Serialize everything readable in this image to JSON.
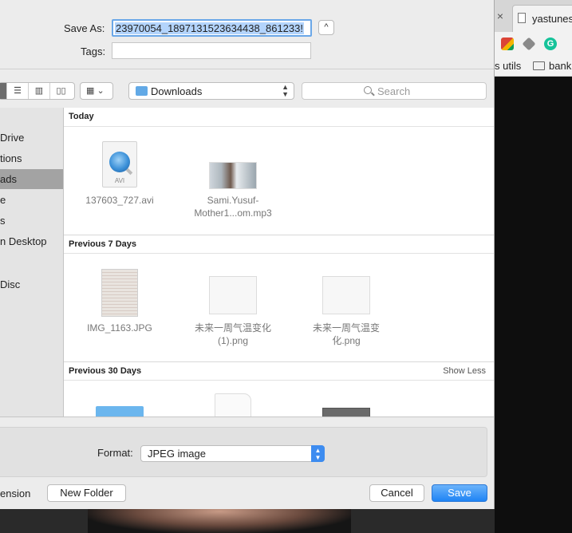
{
  "background_browser": {
    "tab_close_glyph": "×",
    "tab_title": "yastunes",
    "bookmarks": [
      "s utils",
      "bank"
    ],
    "extension_label": "G"
  },
  "save_dialog": {
    "save_as_label": "Save As:",
    "filename": "23970054_1897131523634438_861233!",
    "expand_glyph": "^",
    "tags_label": "Tags:",
    "location": "Downloads",
    "search_placeholder": "Search",
    "sidebar_items": [
      "Drive",
      "tions",
      "ads",
      "e",
      "s",
      "n Desktop",
      "Disc"
    ],
    "selected_sidebar_item": "ads",
    "groups": [
      {
        "title": "Today",
        "files": [
          {
            "name": "137603_727.avi",
            "lines": [
              "137603_727.avi"
            ],
            "kind": "avi-video",
            "ext_label": "AVI"
          },
          {
            "name": "Sami.Yusuf-Mother1...om.mp3",
            "lines": [
              "Sami.Yusuf-",
              "Mother1...om.mp3"
            ],
            "kind": "album-art"
          }
        ]
      },
      {
        "title": "Previous 7 Days",
        "files": [
          {
            "name": "IMG_1163.JPG",
            "lines": [
              "IMG_1163.JPG"
            ],
            "kind": "document-photo"
          },
          {
            "name": "未来一周气温变化(1).png",
            "lines": [
              "未来一周气温变化",
              "(1).png"
            ],
            "kind": "chart-image"
          },
          {
            "name": "未来一周气温变化.png",
            "lines": [
              "未来一周气温变",
              "化.png"
            ],
            "kind": "chart-image"
          }
        ]
      },
      {
        "title": "Previous 30 Days",
        "show_less": "Show Less",
        "files": [
          {
            "kind": "folder"
          },
          {
            "kind": "document"
          },
          {
            "kind": "screenshot-image"
          }
        ]
      }
    ],
    "format_label": "Format:",
    "format_value": "JPEG image",
    "hide_extension_label": "ension",
    "new_folder_label": "New Folder",
    "cancel_label": "Cancel",
    "save_label": "Save",
    "colors": {
      "accent_blue": "#1e84f5",
      "selection_blue": "#b3d4fc",
      "sidebar_selected": "#a3a3a3"
    }
  }
}
